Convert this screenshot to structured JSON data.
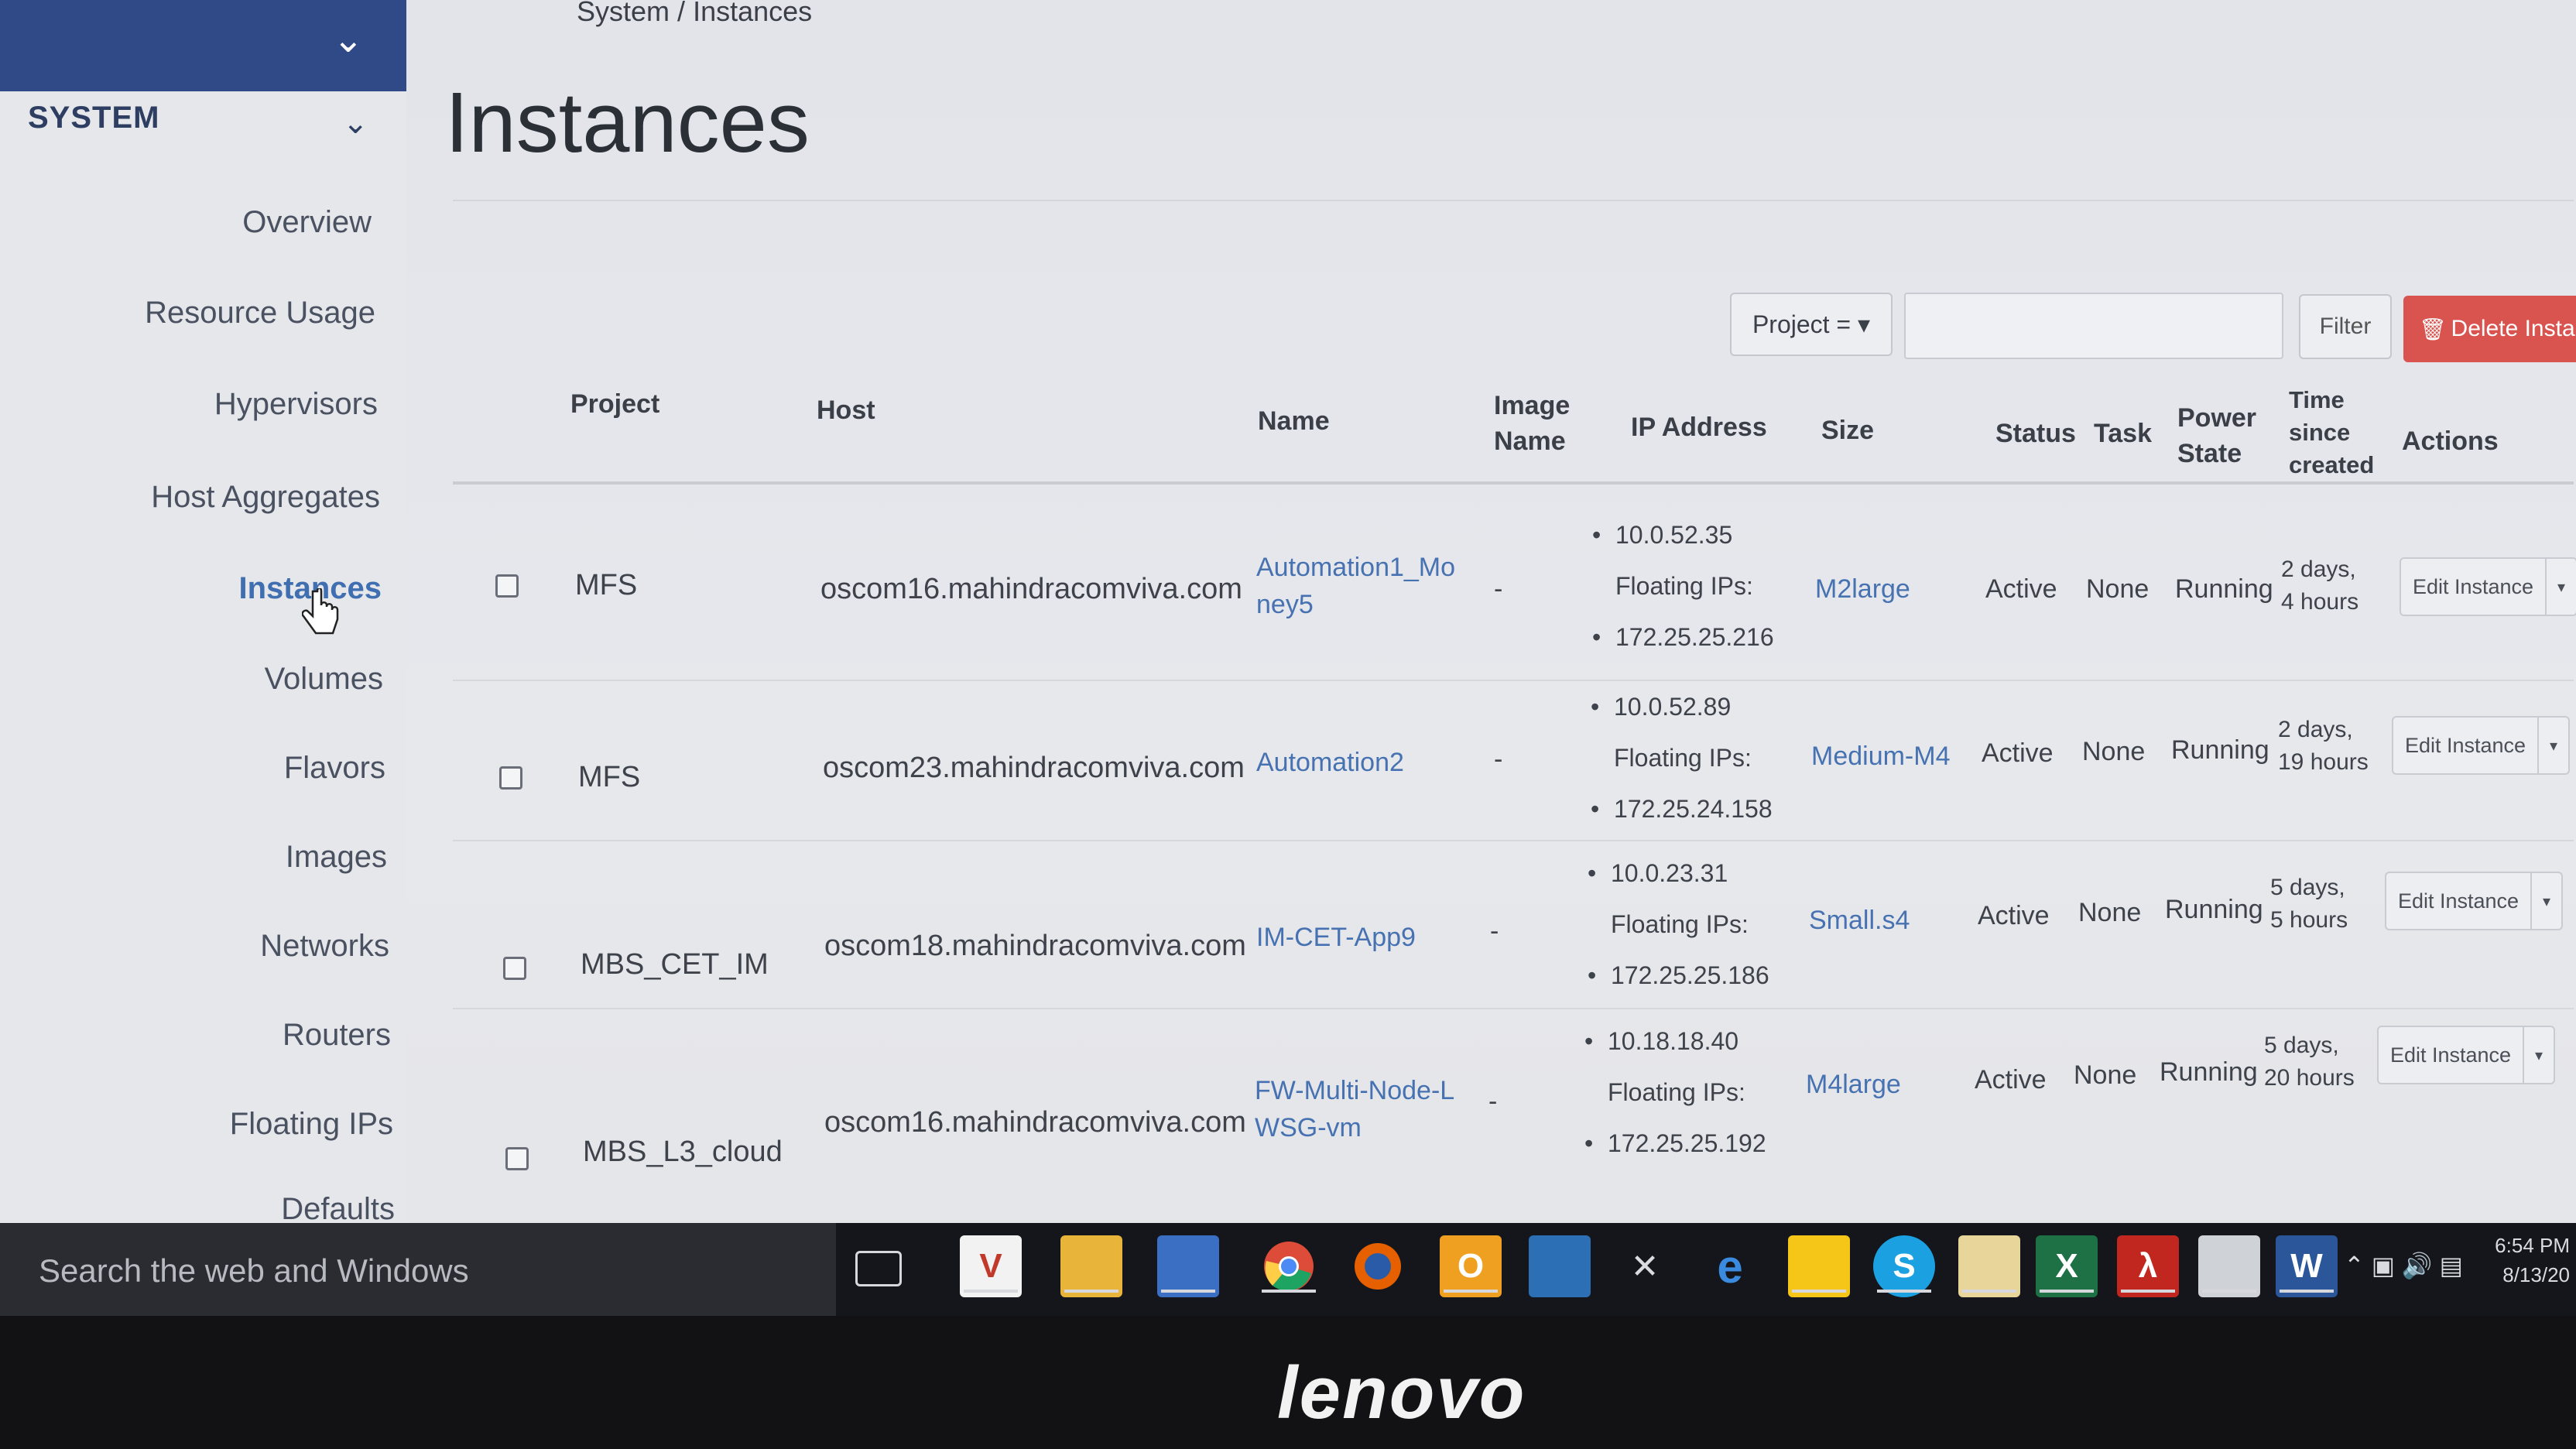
{
  "breadcrumb": {
    "parts": [
      "System",
      "/",
      "Instances"
    ]
  },
  "sidebar": {
    "section": "SYSTEM",
    "items": [
      {
        "label": "Overview"
      },
      {
        "label": "Resource Usage"
      },
      {
        "label": "Hypervisors"
      },
      {
        "label": "Host Aggregates"
      },
      {
        "label": "Instances",
        "active": true
      },
      {
        "label": "Volumes"
      },
      {
        "label": "Flavors"
      },
      {
        "label": "Images"
      },
      {
        "label": "Networks"
      },
      {
        "label": "Routers"
      },
      {
        "label": "Floating IPs"
      },
      {
        "label": "Defaults"
      }
    ]
  },
  "page": {
    "title": "Instances"
  },
  "toolbar": {
    "project_filter": "Project = ▾",
    "filter_label": "Filter",
    "delete_label": "Delete Instance"
  },
  "table": {
    "headers": {
      "project": "Project",
      "host": "Host",
      "name": "Name",
      "image_line1": "Image",
      "image_line2": "Name",
      "ip": "IP Address",
      "size": "Size",
      "status": "Status",
      "task": "Task",
      "power_line1": "Power",
      "power_line2": "State",
      "time_line1": "Time",
      "time_line2": "since",
      "time_line3": "created",
      "actions": "Actions"
    },
    "rows": [
      {
        "project": "MFS",
        "host": "oscom16.mahindracomviva.com",
        "name_line1": "Automation1_Mo",
        "name_line2": "ney5",
        "image": "-",
        "ip": "10.0.52.35",
        "floating_label": "Floating IPs:",
        "floating_ip": "172.25.25.216",
        "size": "M2large",
        "status": "Active",
        "task": "None",
        "power": "Running",
        "time_line1": "2 days,",
        "time_line2": "4 hours",
        "action": "Edit Instance"
      },
      {
        "project": "MFS",
        "host": "oscom23.mahindracomviva.com",
        "name_line1": "Automation2",
        "name_line2": "",
        "image": "-",
        "ip": "10.0.52.89",
        "floating_label": "Floating IPs:",
        "floating_ip": "172.25.24.158",
        "size": "Medium-M4",
        "status": "Active",
        "task": "None",
        "power": "Running",
        "time_line1": "2 days,",
        "time_line2": "19 hours",
        "action": "Edit Instance"
      },
      {
        "project": "MBS_CET_IM",
        "host": "oscom18.mahindracomviva.com",
        "name_line1": "IM-CET-App9",
        "name_line2": "",
        "image": "-",
        "ip": "10.0.23.31",
        "floating_label": "Floating IPs:",
        "floating_ip": "172.25.25.186",
        "size": "Small.s4",
        "status": "Active",
        "task": "None",
        "power": "Running",
        "time_line1": "5 days,",
        "time_line2": "5 hours",
        "action": "Edit Instance"
      },
      {
        "project": "MBS_L3_cloud",
        "host": "oscom16.mahindracomviva.com",
        "name_line1": "FW-Multi-Node-L",
        "name_line2": "WSG-vm",
        "image": "-",
        "ip": "10.18.18.40",
        "floating_label": "Floating IPs:",
        "floating_ip": "172.25.25.192",
        "size": "M4large",
        "status": "Active",
        "task": "None",
        "power": "Running",
        "time_line1": "5 days,",
        "time_line2": "20 hours",
        "action": "Edit Instance"
      }
    ]
  },
  "taskbar": {
    "search_placeholder": "Search the web and Windows",
    "clock_time": "6:54 PM",
    "clock_date": "8/13/20",
    "icons": [
      "task-view-icon",
      "vc-icon",
      "file-explorer-icon",
      "network-icon",
      "chrome-icon",
      "firefox-icon",
      "outlook-icon",
      "remote-desktop-icon",
      "snipping-icon",
      "internet-explorer-icon",
      "app-icon",
      "skype-icon",
      "folder-icon",
      "excel-icon",
      "pdf-icon",
      "notepad-icon",
      "word-icon"
    ]
  },
  "monitor": {
    "brand": "lenovo"
  },
  "colors": {
    "accent": "#2f4a86",
    "link": "#4772b1",
    "danger": "#d9534f"
  }
}
